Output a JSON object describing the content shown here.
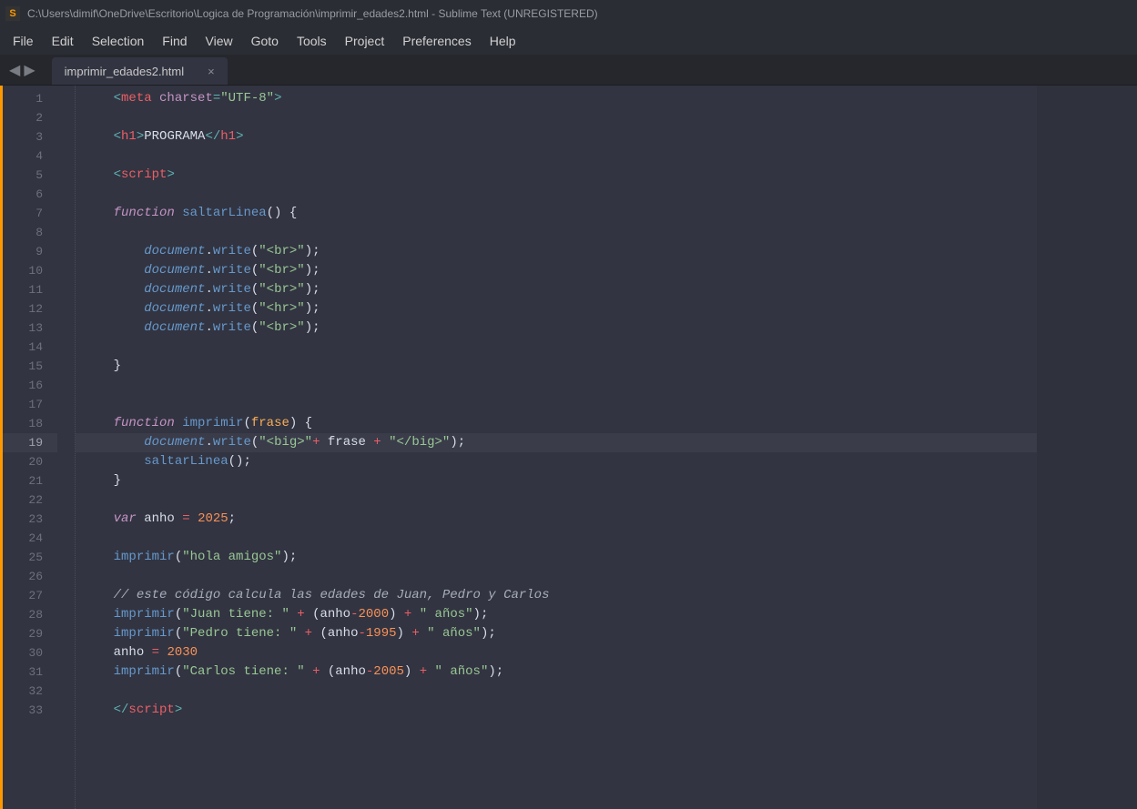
{
  "title": "C:\\Users\\dimif\\OneDrive\\Escritorio\\Logica de Programación\\imprimir_edades2.html - Sublime Text (UNREGISTERED)",
  "app_icon_letter": "S",
  "menu": [
    "File",
    "Edit",
    "Selection",
    "Find",
    "View",
    "Goto",
    "Tools",
    "Project",
    "Preferences",
    "Help"
  ],
  "tab": {
    "name": "imprimir_edades2.html",
    "close": "×"
  },
  "nav": {
    "back": "◀",
    "forward": "▶"
  },
  "active_line": 19,
  "lines": [
    {
      "n": 1,
      "html": "    <span class='p'>&lt;</span><span class='t'>meta</span> <span class='a'>charset</span><span class='p'>=</span><span class='s'>\"UTF-8\"</span><span class='p'>&gt;</span>"
    },
    {
      "n": 2,
      "html": ""
    },
    {
      "n": 3,
      "html": "    <span class='p'>&lt;</span><span class='t'>h1</span><span class='p'>&gt;</span><span class='w'>PROGRAMA</span><span class='p'>&lt;/</span><span class='t'>h1</span><span class='p'>&gt;</span>"
    },
    {
      "n": 4,
      "html": ""
    },
    {
      "n": 5,
      "html": "    <span class='p'>&lt;</span><span class='t'>script</span><span class='p'>&gt;</span>"
    },
    {
      "n": 6,
      "html": ""
    },
    {
      "n": 7,
      "html": "    <span class='kv'>function</span> <span class='fn'>saltarLinea</span><span class='w'>() {</span>"
    },
    {
      "n": 8,
      "html": ""
    },
    {
      "n": 9,
      "html": "        <span class='it'>document</span><span class='w'>.</span><span class='m'>write</span><span class='w'>(</span><span class='s'>\"&lt;br&gt;\"</span><span class='w'>);</span>"
    },
    {
      "n": 10,
      "html": "        <span class='it'>document</span><span class='w'>.</span><span class='m'>write</span><span class='w'>(</span><span class='s'>\"&lt;br&gt;\"</span><span class='w'>);</span>"
    },
    {
      "n": 11,
      "html": "        <span class='it'>document</span><span class='w'>.</span><span class='m'>write</span><span class='w'>(</span><span class='s'>\"&lt;br&gt;\"</span><span class='w'>);</span>"
    },
    {
      "n": 12,
      "html": "        <span class='it'>document</span><span class='w'>.</span><span class='m'>write</span><span class='w'>(</span><span class='s'>\"&lt;hr&gt;\"</span><span class='w'>);</span>"
    },
    {
      "n": 13,
      "html": "        <span class='it'>document</span><span class='w'>.</span><span class='m'>write</span><span class='w'>(</span><span class='s'>\"&lt;br&gt;\"</span><span class='w'>);</span>"
    },
    {
      "n": 14,
      "html": ""
    },
    {
      "n": 15,
      "html": "    <span class='w'>}</span>"
    },
    {
      "n": 16,
      "html": ""
    },
    {
      "n": 17,
      "html": ""
    },
    {
      "n": 18,
      "html": "    <span class='kv'>function</span> <span class='fn'>imprimir</span><span class='w'>(</span><span class='st'>frase</span><span class='w'>) {</span>"
    },
    {
      "n": 19,
      "html": "        <span class='it'>document</span><span class='w'>.</span><span class='m'>write</span><span class='w'>(</span><span class='s'>\"&lt;big&gt;\"</span><span class='op'>+</span><span class='w'> frase </span><span class='op'>+</span><span class='w'> </span><span class='s'>\"&lt;/big&gt;\"</span><span class='w'>);</span>"
    },
    {
      "n": 20,
      "html": "        <span class='fn'>saltarLinea</span><span class='w'>();</span>"
    },
    {
      "n": 21,
      "html": "    <span class='w'>}</span>"
    },
    {
      "n": 22,
      "html": ""
    },
    {
      "n": 23,
      "html": "    <span class='kv'>var</span><span class='w'> anho </span><span class='op'>=</span><span class='w'> </span><span class='n'>2025</span><span class='w'>;</span>"
    },
    {
      "n": 24,
      "html": ""
    },
    {
      "n": 25,
      "html": "    <span class='fn'>imprimir</span><span class='w'>(</span><span class='s'>\"hola amigos\"</span><span class='w'>);</span>"
    },
    {
      "n": 26,
      "html": ""
    },
    {
      "n": 27,
      "html": "    <span class='c'>// este código calcula las edades de Juan, Pedro y Carlos</span>"
    },
    {
      "n": 28,
      "html": "    <span class='fn'>imprimir</span><span class='w'>(</span><span class='s'>\"Juan tiene: \"</span><span class='w'> </span><span class='op'>+</span><span class='w'> (anho</span><span class='op'>-</span><span class='n'>2000</span><span class='w'>) </span><span class='op'>+</span><span class='w'> </span><span class='s'>\" años\"</span><span class='w'>);</span>"
    },
    {
      "n": 29,
      "html": "    <span class='fn'>imprimir</span><span class='w'>(</span><span class='s'>\"Pedro tiene: \"</span><span class='w'> </span><span class='op'>+</span><span class='w'> (anho</span><span class='op'>-</span><span class='n'>1995</span><span class='w'>) </span><span class='op'>+</span><span class='w'> </span><span class='s'>\" años\"</span><span class='w'>);</span>"
    },
    {
      "n": 30,
      "html": "    <span class='w'>anho </span><span class='op'>=</span><span class='w'> </span><span class='n'>2030</span>"
    },
    {
      "n": 31,
      "html": "    <span class='fn'>imprimir</span><span class='w'>(</span><span class='s'>\"Carlos tiene: \"</span><span class='w'> </span><span class='op'>+</span><span class='w'> (anho</span><span class='op'>-</span><span class='n'>2005</span><span class='w'>) </span><span class='op'>+</span><span class='w'> </span><span class='s'>\" años\"</span><span class='w'>);</span>"
    },
    {
      "n": 32,
      "html": ""
    },
    {
      "n": 33,
      "html": "    <span class='p'>&lt;/</span><span class='t'>script</span><span class='p'>&gt;</span>"
    }
  ]
}
